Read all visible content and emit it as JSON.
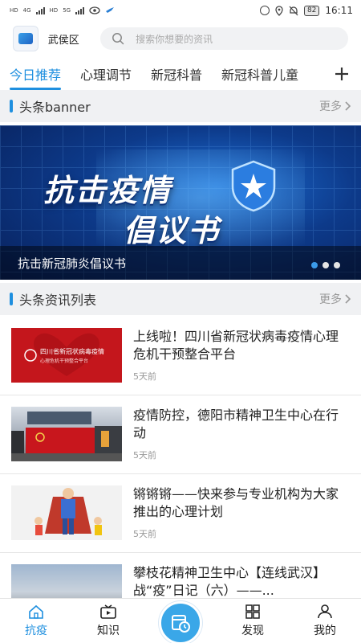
{
  "status_bar": {
    "left_small_1": "HD",
    "left_small_2": "4G",
    "left_small_3": "HD",
    "left_small_4": "5G",
    "battery": "82",
    "time": "16:11"
  },
  "header": {
    "district": "武侯区",
    "search_placeholder": "搜索你想要的资讯"
  },
  "tabs": [
    {
      "label": "今日推荐",
      "active": true
    },
    {
      "label": "心理调节",
      "active": false
    },
    {
      "label": "新冠科普",
      "active": false
    },
    {
      "label": "新冠科普儿童",
      "active": false
    }
  ],
  "banner_section": {
    "title": "头条banner",
    "more": "更多"
  },
  "banner": {
    "headline_line1": "抗击疫情",
    "headline_line2": "倡议书",
    "caption": "抗击新冠肺炎倡议书",
    "active_dot": 1,
    "dot_count": 3
  },
  "news_section": {
    "title": "头条资讯列表",
    "more": "更多"
  },
  "news": [
    {
      "title": "上线啦！四川省新冠状病毒疫情心理危机干预整合平台",
      "time": "5天前",
      "thumb_text": "四川省新冠状病毒疫情",
      "thumb_sub": "心理危机干预整合平台"
    },
    {
      "title": "疫情防控，德阳市精神卫生中心在行动",
      "time": "5天前"
    },
    {
      "title": "锵锵锵——快来参与专业机构为大家推出的心理计划",
      "time": "5天前"
    },
    {
      "title": "攀枝花精神卫生中心【连线武汉】战“疫”日记（六）——...",
      "time": ""
    }
  ],
  "bottom_nav": [
    {
      "label": "抗疫",
      "icon": "home-icon",
      "active": true
    },
    {
      "label": "知识",
      "icon": "tv-icon",
      "active": false
    },
    {
      "label": "",
      "icon": "calendar-clock-icon",
      "active": false
    },
    {
      "label": "发现",
      "icon": "grid-icon",
      "active": false
    },
    {
      "label": "我的",
      "icon": "person-icon",
      "active": false
    }
  ],
  "colors": {
    "accent": "#1e8fdf",
    "section_bg": "#f0f1f3"
  }
}
